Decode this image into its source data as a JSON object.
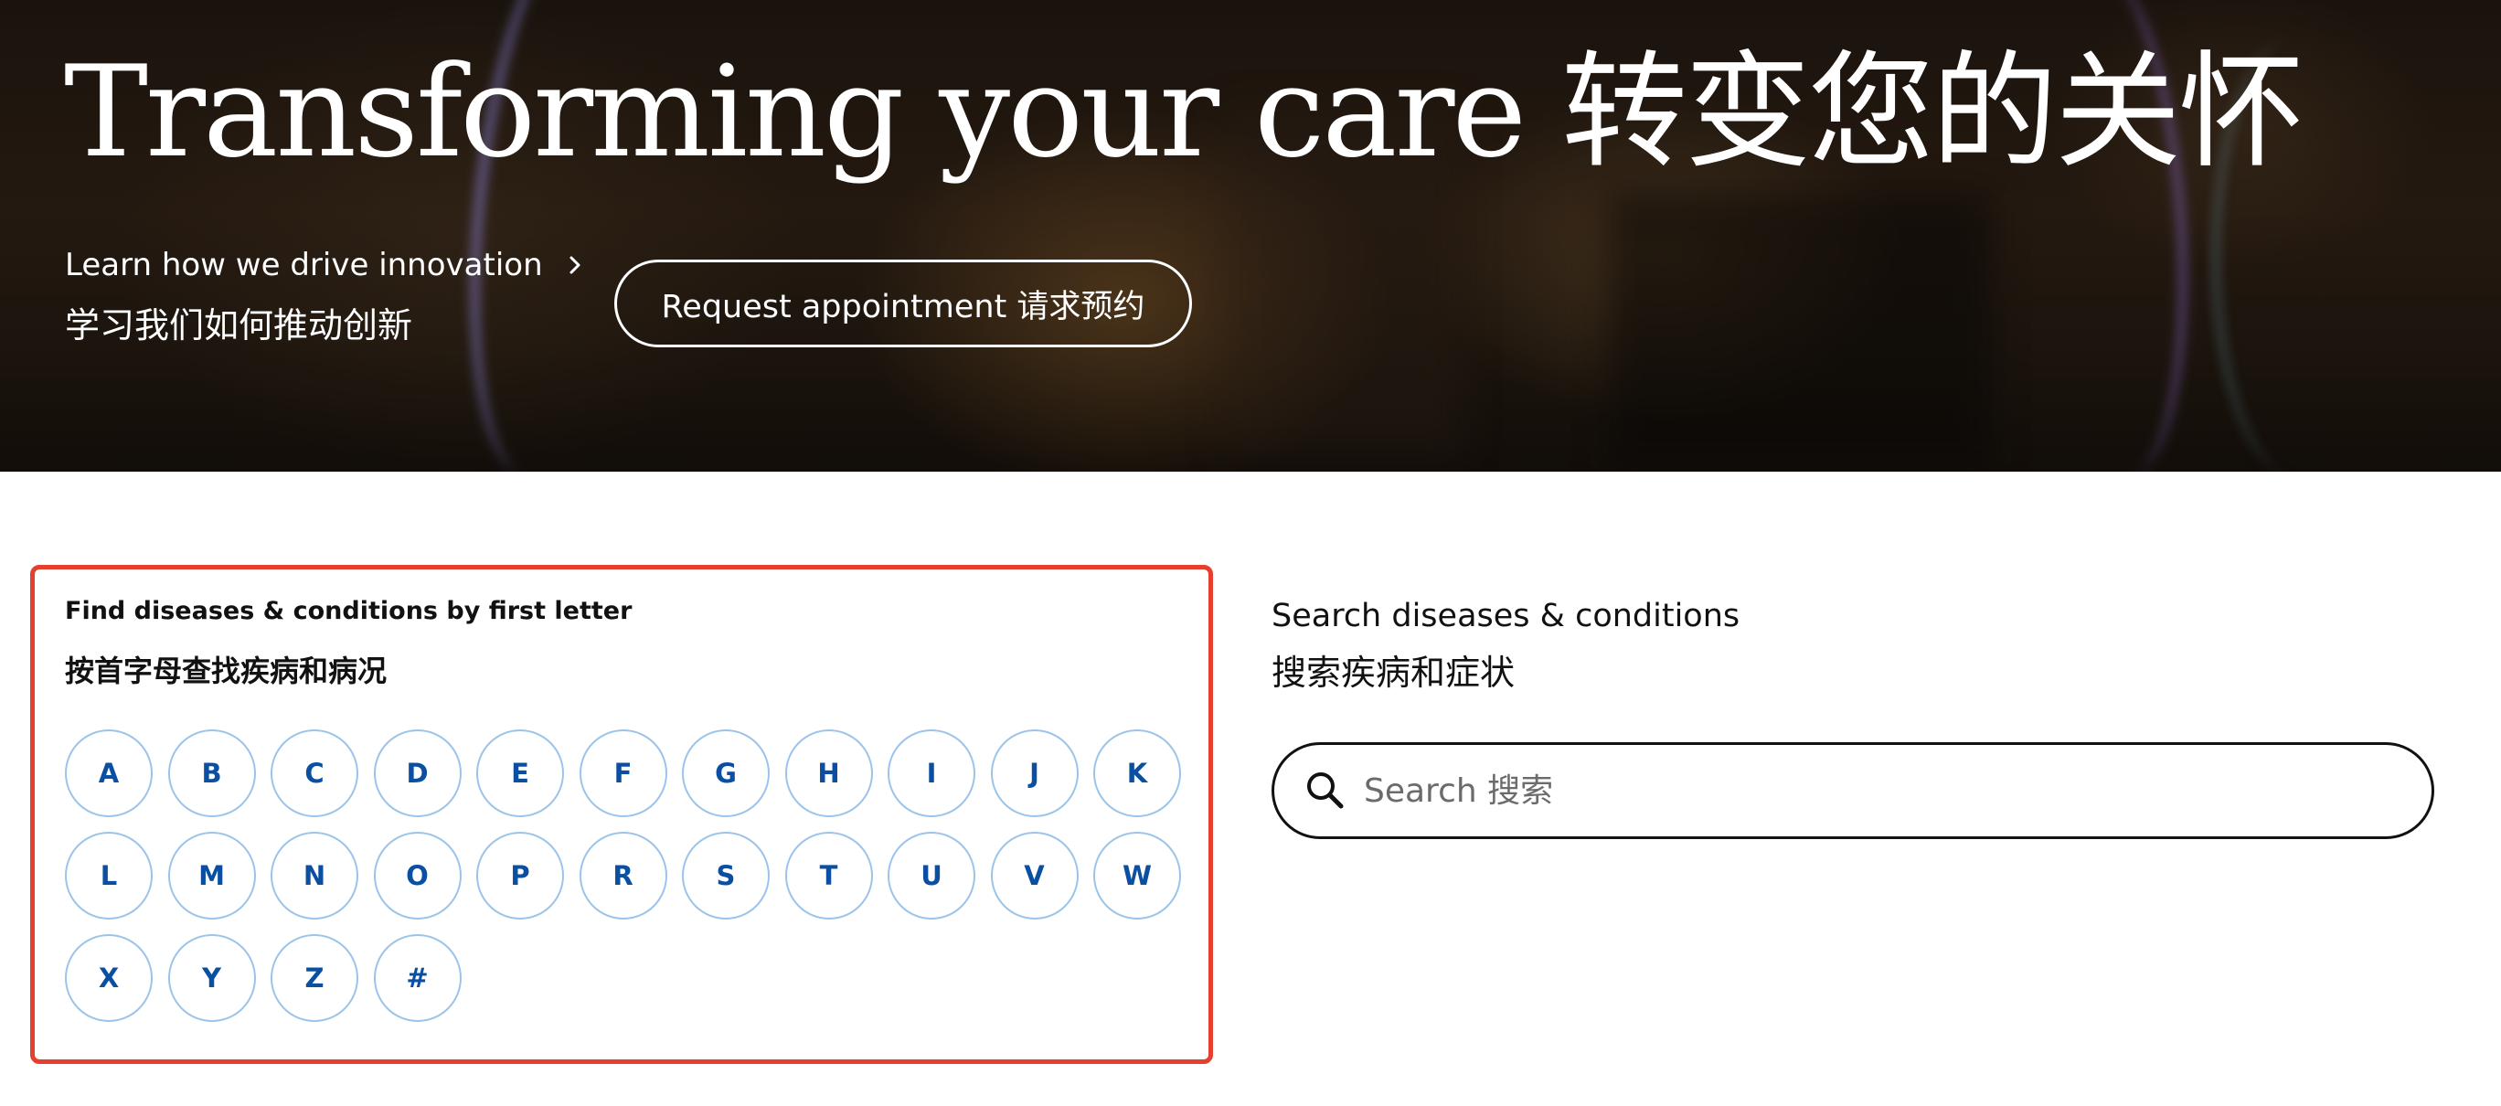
{
  "hero": {
    "title": "Transforming your care 转变您的关怀",
    "link_line1": "Learn how we drive innovation",
    "link_line2": "学习我们如何推动创新",
    "appointment_button": "Request appointment 请求预约"
  },
  "letter_panel": {
    "title": "Find diseases & conditions by first letter",
    "subtitle": "按首字母查找疾病和病况",
    "letters": [
      "A",
      "B",
      "C",
      "D",
      "E",
      "F",
      "G",
      "H",
      "I",
      "J",
      "K",
      "L",
      "M",
      "N",
      "O",
      "P",
      "R",
      "S",
      "T",
      "U",
      "V",
      "W",
      "X",
      "Y",
      "Z",
      "#"
    ],
    "highlight_border_color": "#e5402e",
    "letter_color": "#0b4fa3",
    "circle_border_color": "#9cc4ea"
  },
  "search": {
    "title": "Search diseases & conditions",
    "subtitle": "搜索疾病和症状",
    "placeholder": "Search 搜索",
    "icon": "search-icon"
  }
}
